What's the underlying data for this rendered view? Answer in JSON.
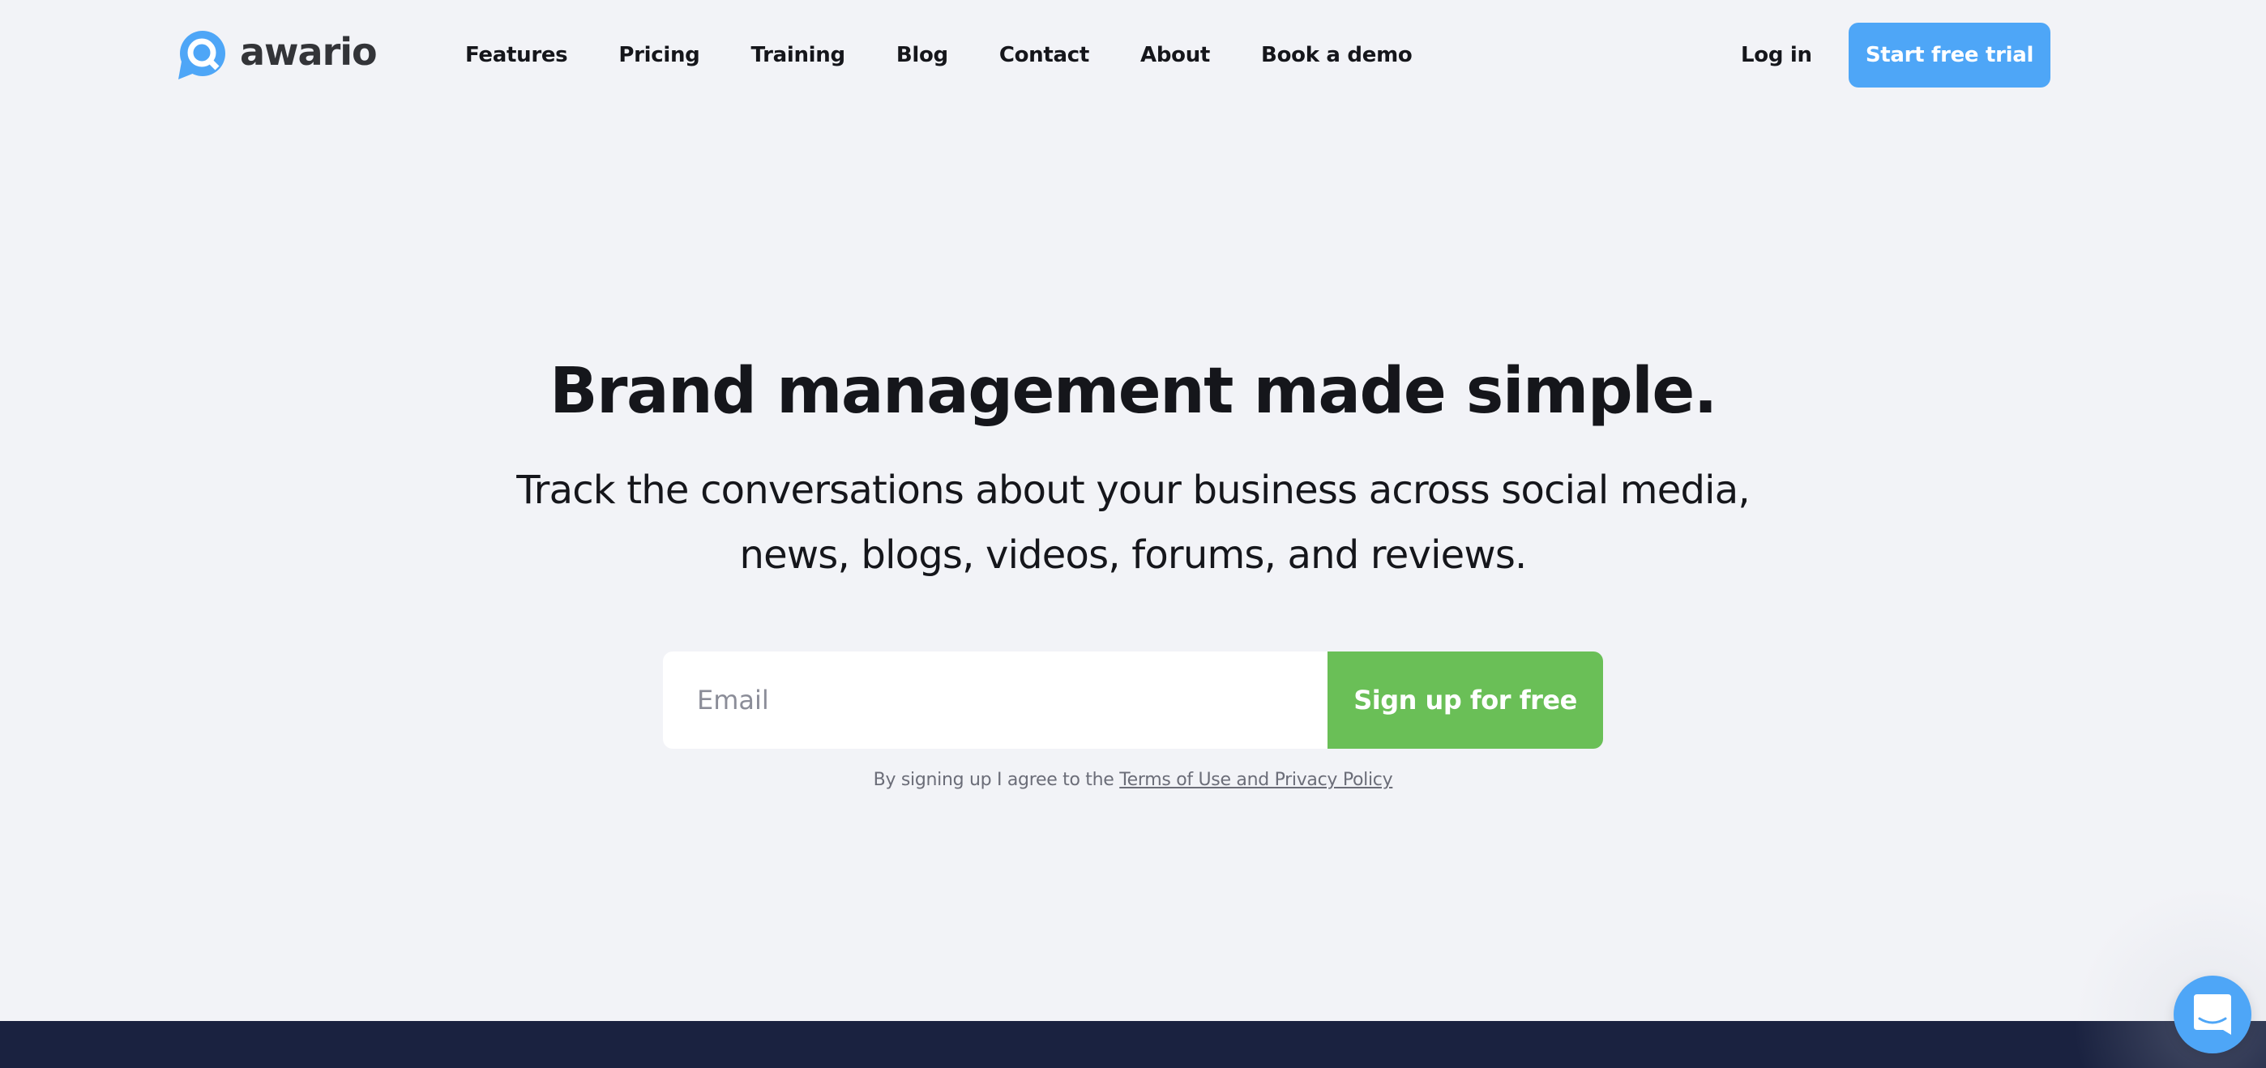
{
  "brand": {
    "name": "awario",
    "logo_icon": "chat-search-icon",
    "color": "#4ea6f7"
  },
  "nav": {
    "items": [
      {
        "label": "Features"
      },
      {
        "label": "Pricing"
      },
      {
        "label": "Training"
      },
      {
        "label": "Blog"
      },
      {
        "label": "Contact"
      },
      {
        "label": "About"
      },
      {
        "label": "Book a demo"
      }
    ],
    "login_label": "Log in",
    "cta_label": "Start free trial"
  },
  "hero": {
    "title": "Brand management made simple.",
    "subtitle": "Track the conversations about your business across social media, news, blogs, videos, forums, and reviews."
  },
  "signup": {
    "email_placeholder": "Email",
    "email_value": "",
    "button_label": "Sign up for free",
    "terms_prefix": "By signing up I agree to the ",
    "terms_link": "Terms of Use and Privacy Policy"
  },
  "chat_widget": {
    "icon": "chat-bubble-icon"
  },
  "colors": {
    "background": "#f2f3f7",
    "primary_blue": "#4ea6f7",
    "signup_green": "#6abf57",
    "footer_navy": "#1a2240",
    "text_dark": "#15161b"
  }
}
